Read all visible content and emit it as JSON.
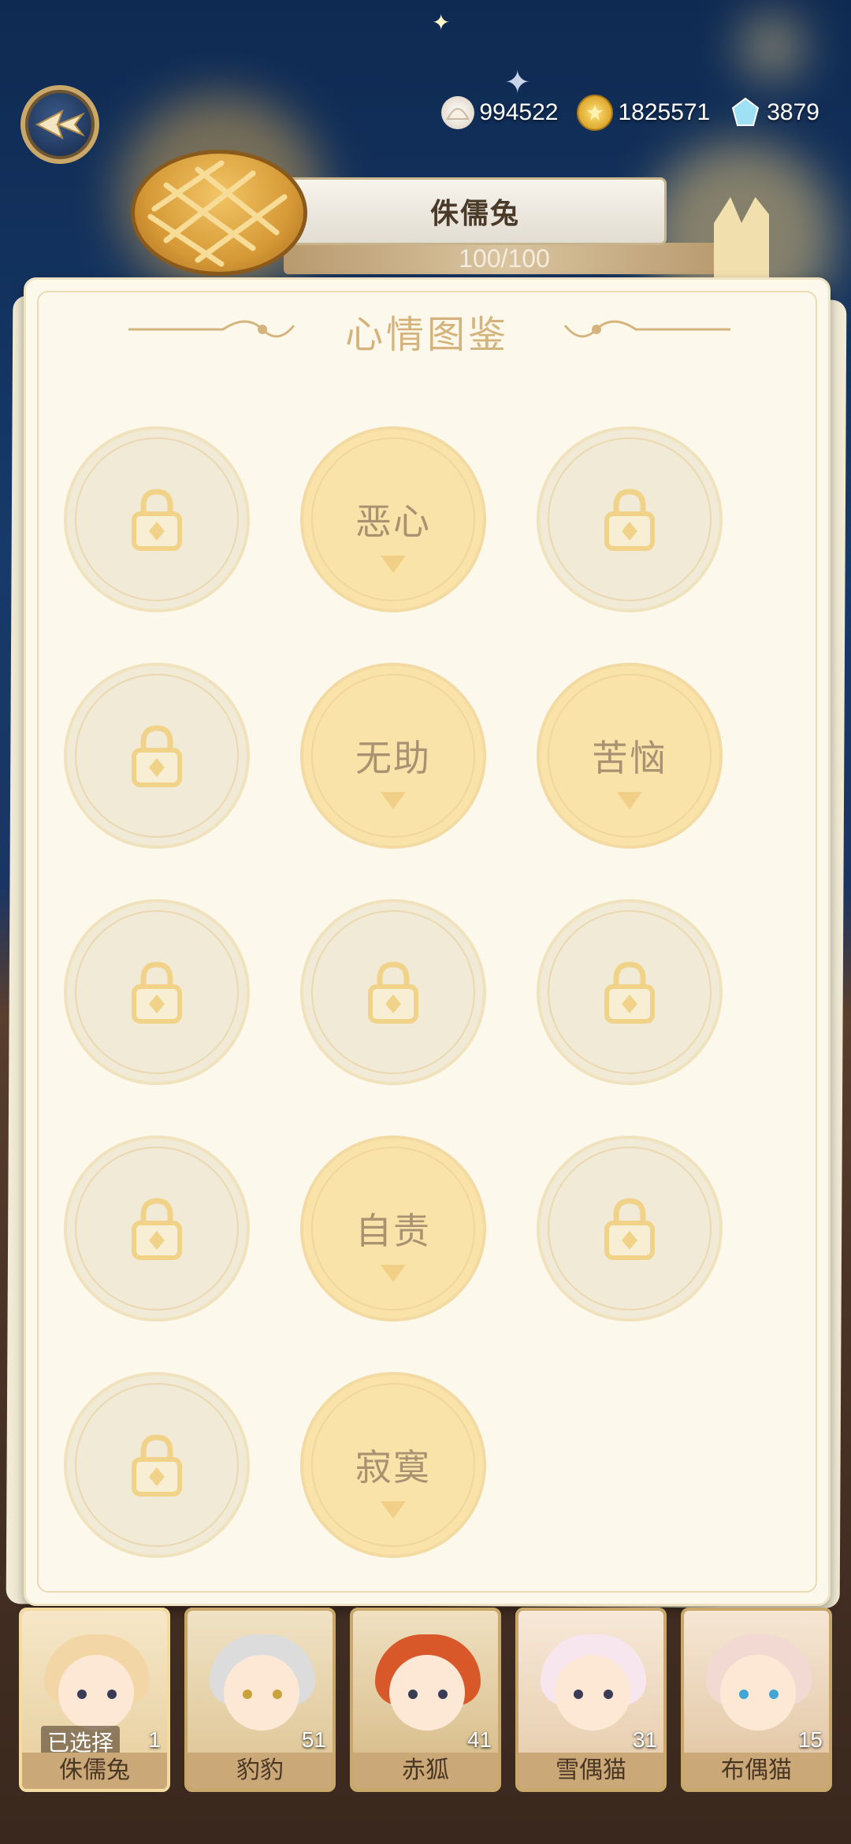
{
  "currencies": [
    {
      "icon": "shell-coin-icon",
      "value": "994522"
    },
    {
      "icon": "gold-coin-icon",
      "value": "1825571"
    },
    {
      "icon": "crystal-icon",
      "value": "3879"
    }
  ],
  "pet": {
    "name": "侏儒兔",
    "hp_text": "100/100",
    "hp_fraction": 1.0
  },
  "panel": {
    "title": "心情图鉴"
  },
  "moods": [
    {
      "label": "",
      "unlocked": false
    },
    {
      "label": "恶心",
      "unlocked": true
    },
    {
      "label": "",
      "unlocked": false
    },
    {
      "label": "",
      "unlocked": false
    },
    {
      "label": "无助",
      "unlocked": true
    },
    {
      "label": "苦恼",
      "unlocked": true
    },
    {
      "label": "",
      "unlocked": false
    },
    {
      "label": "",
      "unlocked": false
    },
    {
      "label": "",
      "unlocked": false
    },
    {
      "label": "",
      "unlocked": false
    },
    {
      "label": "自责",
      "unlocked": true
    },
    {
      "label": "",
      "unlocked": false
    },
    {
      "label": "",
      "unlocked": false
    },
    {
      "label": "寂寞",
      "unlocked": true
    }
  ],
  "characters": [
    {
      "name": "侏儒兔",
      "level": "1",
      "selected_label": "已选择",
      "hair": "#f3d6a6"
    },
    {
      "name": "豹豹",
      "level": "51",
      "selected_label": "",
      "hair": "#dcdcdc"
    },
    {
      "name": "赤狐",
      "level": "41",
      "selected_label": "",
      "hair": "#d9582a"
    },
    {
      "name": "雪偶猫",
      "level": "31",
      "selected_label": "",
      "hair": "#f7e6ee"
    },
    {
      "name": "布偶猫",
      "level": "15",
      "selected_label": "",
      "hair": "#f2d9d2"
    }
  ]
}
